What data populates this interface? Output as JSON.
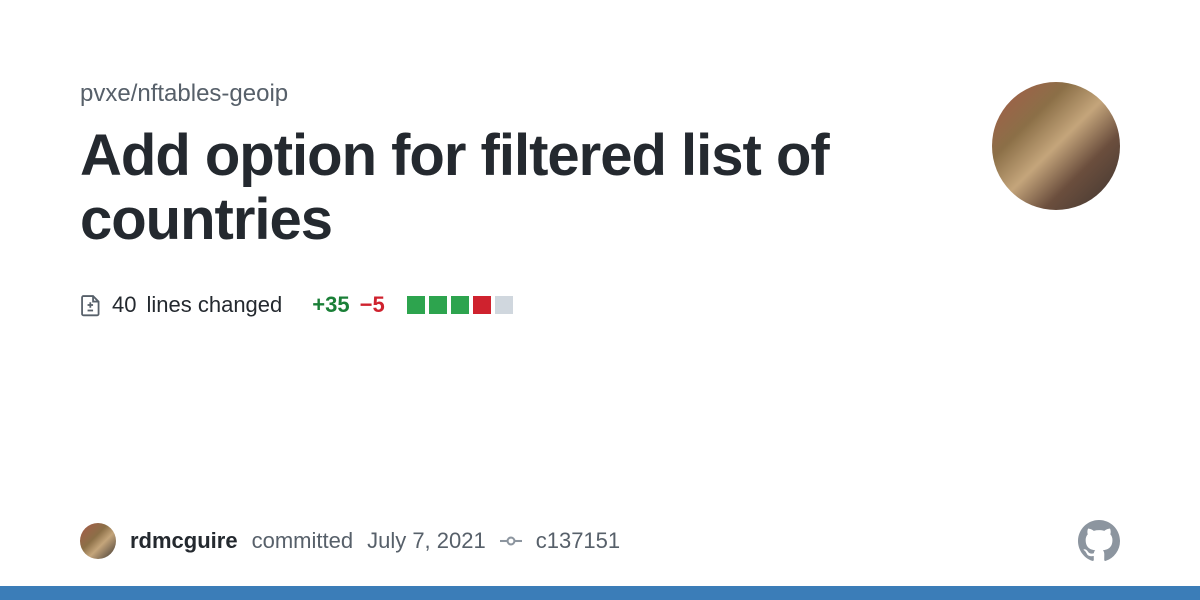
{
  "repo": "pvxe/nftables-geoip",
  "title": "Add option for filtered list of countries",
  "diff": {
    "lines_count": "40",
    "lines_text": "lines changed",
    "additions": "+35",
    "deletions": "−5",
    "blocks": [
      "green",
      "green",
      "green",
      "red",
      "gray"
    ]
  },
  "author": {
    "name": "rdmcguire",
    "action": "committed",
    "date": "July 7, 2021",
    "commit_hash": "c137151"
  }
}
